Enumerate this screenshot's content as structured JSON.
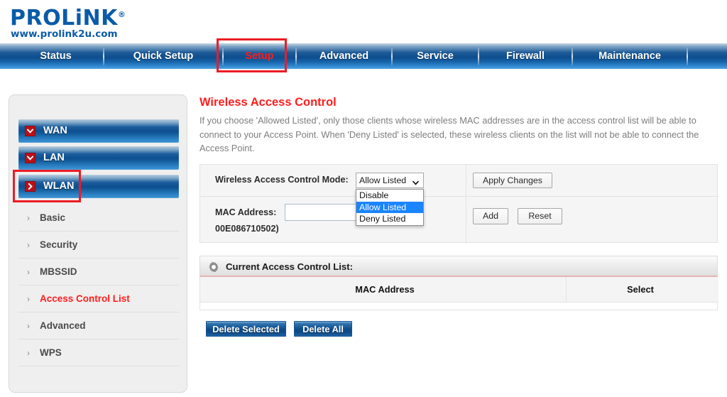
{
  "brand": {
    "name": "PROLiNK",
    "registered": "®",
    "url": "www.prolink2u.com"
  },
  "topnav": {
    "items": [
      {
        "label": "Status",
        "active": false
      },
      {
        "label": "Quick Setup",
        "active": false
      },
      {
        "label": "Setup",
        "active": true
      },
      {
        "label": "Advanced",
        "active": false
      },
      {
        "label": "Service",
        "active": false
      },
      {
        "label": "Firewall",
        "active": false
      },
      {
        "label": "Maintenance",
        "active": false
      }
    ],
    "highlight_color": "#ec1c24",
    "active_color": "#ff1d1d"
  },
  "sidebar": {
    "groups": [
      {
        "label": "WAN",
        "icon": "chevron-down-icon"
      },
      {
        "label": "LAN",
        "icon": "chevron-down-icon"
      },
      {
        "label": "WLAN",
        "icon": "chevron-right-icon",
        "highlighted": true
      }
    ],
    "items": [
      {
        "label": "Basic",
        "selected": false
      },
      {
        "label": "Security",
        "selected": false
      },
      {
        "label": "MBSSID",
        "selected": false
      },
      {
        "label": "Access Control List",
        "selected": true
      },
      {
        "label": "Advanced",
        "selected": false
      },
      {
        "label": "WPS",
        "selected": false
      }
    ]
  },
  "main": {
    "title": "Wireless Access Control",
    "description": "If you choose 'Allowed Listed', only those clients whose wireless MAC addresses are in the access control list will be able to connect to your Access Point. When 'Deny Listed' is selected, these wireless clients on the list will not be able to connect the Access Point."
  },
  "form": {
    "mode_label": "Wireless Access Control Mode:",
    "mode_select": {
      "value": "Allow Listed",
      "expanded": true,
      "options": [
        {
          "label": "Disable",
          "highlighted": false
        },
        {
          "label": "Allow Listed",
          "highlighted": true
        },
        {
          "label": "Deny Listed",
          "highlighted": false
        }
      ]
    },
    "apply_button": "Apply Changes",
    "mac_label": "MAC Address:",
    "mac_hint": "00E086710502)",
    "mac_value": "",
    "mac_placeholder": "",
    "add_button": "Add",
    "reset_button": "Reset"
  },
  "list": {
    "header": "Current Access Control List:",
    "header_icon": "gear-icon",
    "columns": [
      "MAC Address",
      "Select"
    ],
    "rows": []
  },
  "actions": {
    "delete_selected": "Delete Selected",
    "delete_all": "Delete All"
  }
}
